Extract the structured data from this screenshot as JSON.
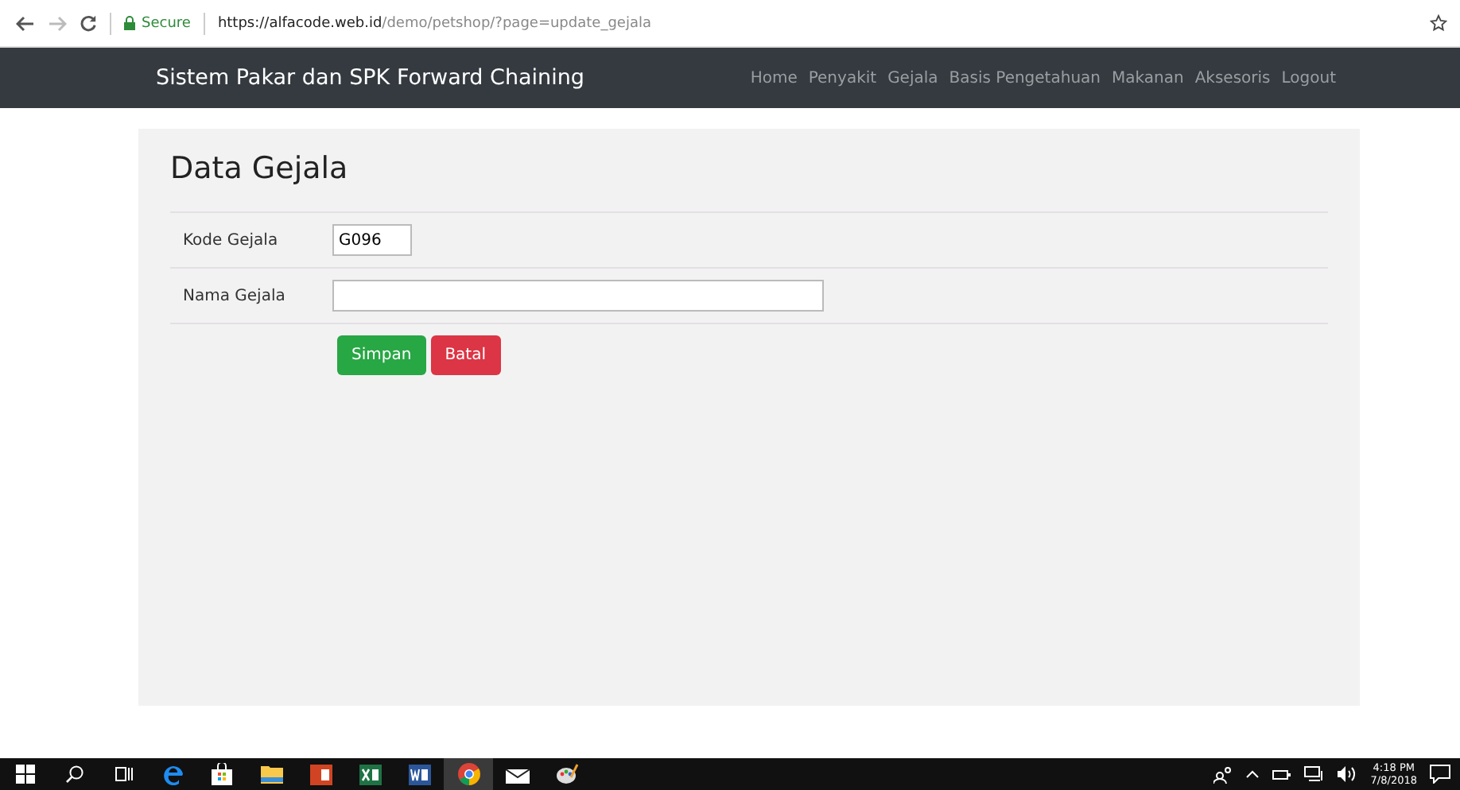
{
  "browser": {
    "secure_label": "Secure",
    "url_host": "https://alfacode.web.id",
    "url_path": "/demo/petshop/?page=update_gejala"
  },
  "navbar": {
    "brand": "Sistem Pakar dan SPK Forward Chaining",
    "links": [
      "Home",
      "Penyakit",
      "Gejala",
      "Basis Pengetahuan",
      "Makanan",
      "Aksesoris",
      "Logout"
    ]
  },
  "card": {
    "title": "Data Gejala",
    "fields": [
      {
        "label": "Kode Gejala",
        "value": "G096"
      },
      {
        "label": "Nama Gejala"
      }
    ],
    "buttons": [
      {
        "label": "Simpan",
        "kind": "success"
      },
      {
        "label": "Batal",
        "kind": "danger"
      }
    ]
  },
  "taskbar": {
    "apps": [
      {
        "kind": "start",
        "selected": false
      },
      {
        "kind": "search",
        "selected": false
      },
      {
        "kind": "taskview",
        "selected": false
      },
      {
        "kind": "edge",
        "selected": false
      },
      {
        "kind": "store",
        "selected": false
      },
      {
        "kind": "folder",
        "selected": false
      },
      {
        "kind": "powerpoint",
        "selected": false
      },
      {
        "kind": "excel",
        "selected": false
      },
      {
        "kind": "word",
        "selected": false
      },
      {
        "kind": "chrome",
        "selected": true
      },
      {
        "kind": "mail",
        "selected": false
      },
      {
        "kind": "paint",
        "selected": false
      }
    ],
    "time": "4:18 PM",
    "date": "7/8/2018"
  }
}
